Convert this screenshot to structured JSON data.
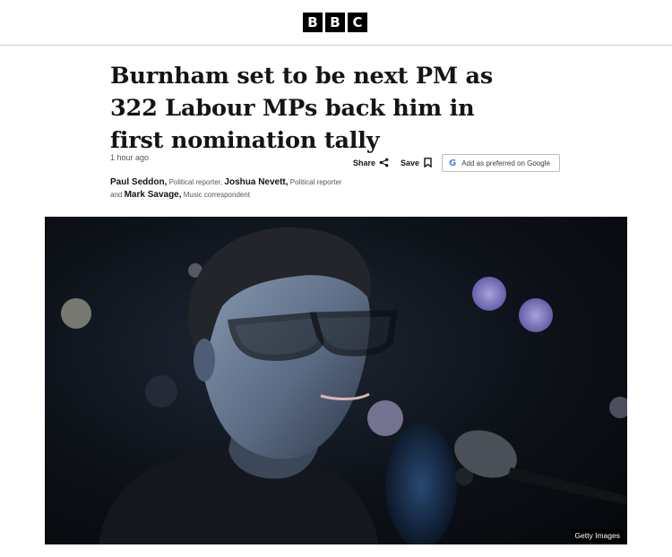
{
  "masthead": {
    "logo_letters": [
      "B",
      "B",
      "C"
    ]
  },
  "article": {
    "headline": "Burnham set to be next PM as 322 Labour MPs back him in first nomination tally",
    "timestamp": "1 hour ago",
    "actions": {
      "share_label": "Share",
      "save_label": "Save",
      "google_label": "Add as preferred on Google"
    },
    "byline": {
      "author1": "Paul Seddon,",
      "role1": "Political reporter,",
      "author2": "Joshua Nevett,",
      "role2": "Political reporter and",
      "author3": "Mark Savage,",
      "role3": "Music correspondent"
    },
    "image": {
      "credit": "Getty Images"
    }
  },
  "colors": {
    "brand": "#000000",
    "text": "#141414",
    "muted": "#545658"
  },
  "icons": [
    "share-icon",
    "bookmark-icon",
    "google-g-icon"
  ]
}
